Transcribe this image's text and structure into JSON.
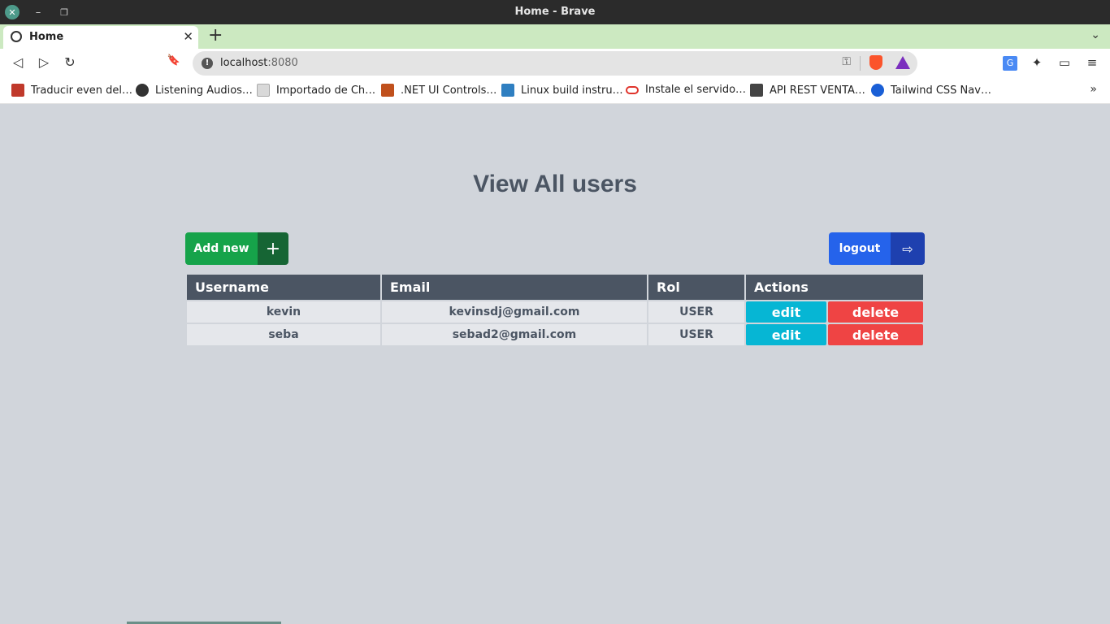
{
  "window": {
    "title": "Home - Brave",
    "close_glyph": "✕",
    "min_glyph": "–",
    "max_glyph": "❐"
  },
  "tabs": [
    {
      "label": "Home",
      "icon": "globe-icon",
      "close_glyph": "✕"
    }
  ],
  "tabstrip": {
    "new_tab_glyph": "+",
    "tab_list_glyph": "⌄"
  },
  "toolbar": {
    "back_glyph": "◁",
    "forward_glyph": "▷",
    "reload_glyph": "↻",
    "bookmark_glyph": "🔖",
    "url_host": "localhost",
    "url_port": ":8080",
    "info_glyph": "!",
    "key_glyph": "⚿",
    "extensions_glyph": "✦",
    "wallet_glyph": "▭",
    "menu_glyph": "≡",
    "translate_glyph": "G"
  },
  "bookmarks": [
    {
      "label": "Traducir even del…",
      "color": "#c0392b"
    },
    {
      "label": "Listening Audios…",
      "color": "#333333"
    },
    {
      "label": "Importado de Ch…",
      "color": "#d9d9d9"
    },
    {
      "label": ".NET UI Controls…",
      "color": "#c0501c"
    },
    {
      "label": "Linux build instru…",
      "color": "#2f7fc1"
    },
    {
      "label": "Instale el servido…",
      "color": "#e0342c"
    },
    {
      "label": "API REST VENTA…",
      "color": "#444444"
    },
    {
      "label": "Tailwind CSS Nav…",
      "color": "#1a5fd6"
    }
  ],
  "bookmarks_more_glyph": "»",
  "page": {
    "heading": "View All users",
    "add_button": {
      "label": "Add new",
      "icon_glyph": "+"
    },
    "logout_button": {
      "label": "logout",
      "icon_glyph": "⇨"
    },
    "table": {
      "headers": [
        "Username",
        "Email",
        "Rol",
        "Actions"
      ],
      "rows": [
        {
          "username": "kevin",
          "email": "kevinsdj@gmail.com",
          "rol": "USER",
          "edit": "edit",
          "delete": "delete"
        },
        {
          "username": "seba",
          "email": "sebad2@gmail.com",
          "rol": "USER",
          "edit": "edit",
          "delete": "delete"
        }
      ]
    }
  },
  "colors": {
    "page_bg": "#d1d5db",
    "add_green": "#16a34a",
    "logout_blue": "#2563eb",
    "edit_cyan": "#06b6d4",
    "delete_red": "#ef4444",
    "table_header": "#4b5563"
  }
}
